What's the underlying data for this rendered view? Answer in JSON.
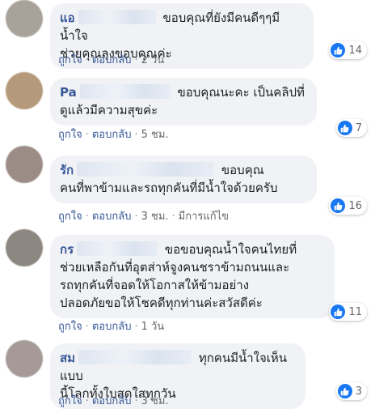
{
  "comments": [
    {
      "name_visible": "แอ",
      "text": "ขอบคุณที่ยังมีคนดีๆๆมีน้ำใจช่วยคุณลุงขอบคุณค่ะ",
      "line1": "ขอบคุณที่ยังมีคนดีๆๆมีน้ำใจ",
      "line2": "ช่วยคุณลุงขอบคุณค่ะ",
      "like_label": "ถูกใจ",
      "reply_label": "ตอบกลับ",
      "time": "2 วัน",
      "reactions": "14"
    },
    {
      "name_visible": "Pa",
      "line1": "ขอบคุณนะคะ เป็นคลิปที่",
      "line2": "ดูแล้วมีความสุขค่ะ",
      "like_label": "ถูกใจ",
      "reply_label": "ตอบกลับ",
      "time": "5 ชม.",
      "reactions": "7"
    },
    {
      "name_visible": "รัก",
      "line1": "ขอบคุณ",
      "line2": "คนที่พาข้ามและรถทุกคันที่มีน้ำใจด้วยครับ",
      "like_label": "ถูกใจ",
      "reply_label": "ตอบกลับ",
      "time": "3 ชม.",
      "edited": "มีการแก้ไข",
      "reactions": "16"
    },
    {
      "name_visible": "กร",
      "line1": "ขอขอบคุณน้ำใจคนไทยที่",
      "line2": "ช่วยเหลือกันที่อุตส่าห์จูงคนชราข้ามถนนและ",
      "line3": "รถทุกคันที่จอดให้โอกาสให้ข้ามอย่าง",
      "line4": "ปลอดภัยขอให้โชคดีทุกท่านค่ะสวัสดีค่ะ",
      "like_label": "ถูกใจ",
      "reply_label": "ตอบกลับ",
      "time": "1 วัน",
      "reactions": "11"
    },
    {
      "name_visible": "สม",
      "line1": "ทุกคนมีน้ำใจเห็นแบบ",
      "line2": "นี้โลกทั้งใบสดใสทุกวัน",
      "like_label": "ถูกใจ",
      "reply_label": "ตอบกลับ",
      "time": "3 ชม.",
      "reactions": "3"
    }
  ],
  "colors": {
    "accent": "#385898",
    "like_blue": "#1877f2",
    "bubble": "#f0f2f5"
  },
  "icons": {
    "reaction": "thumbs-up-icon"
  }
}
